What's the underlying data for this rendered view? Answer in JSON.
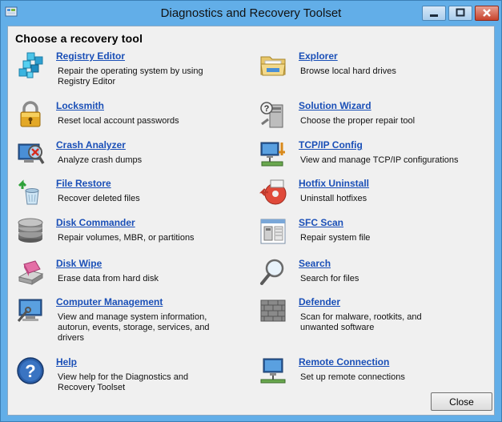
{
  "window": {
    "title": "Diagnostics and Recovery Toolset"
  },
  "heading": "Choose a recovery tool",
  "tools_left": [
    {
      "name": "Registry Editor",
      "desc": "Repair the operating system by using Registry Editor",
      "icon": "registry-icon"
    },
    {
      "name": "Locksmith",
      "desc": "Reset local account passwords",
      "icon": "padlock-icon"
    },
    {
      "name": "Crash Analyzer",
      "desc": "Analyze crash dumps",
      "icon": "crash-analyzer-icon"
    },
    {
      "name": "File Restore",
      "desc": "Recover deleted files",
      "icon": "recycle-bin-icon"
    },
    {
      "name": "Disk Commander",
      "desc": "Repair volumes, MBR, or partitions",
      "icon": "disk-stack-icon"
    },
    {
      "name": "Disk Wipe",
      "desc": "Erase data from hard disk",
      "icon": "eraser-icon"
    },
    {
      "name": "Computer Management",
      "desc": "View and manage system information, autorun, events, storage, services, and drivers",
      "icon": "computer-management-icon"
    },
    {
      "name": "Help",
      "desc": "View help for the Diagnostics and Recovery Toolset",
      "icon": "help-icon"
    }
  ],
  "tools_right": [
    {
      "name": "Explorer",
      "desc": "Browse local hard drives",
      "icon": "folder-icon"
    },
    {
      "name": "Solution Wizard",
      "desc": "Choose the proper repair tool",
      "icon": "wizard-icon"
    },
    {
      "name": "TCP/IP Config",
      "desc": "View and manage TCP/IP configurations",
      "icon": "network-config-icon"
    },
    {
      "name": "Hotfix Uninstall",
      "desc": "Uninstall hotfixes",
      "icon": "hotfix-uninstall-icon"
    },
    {
      "name": "SFC Scan",
      "desc": "Repair system file",
      "icon": "sfc-scan-icon"
    },
    {
      "name": "Search",
      "desc": "Search for files",
      "icon": "magnifier-icon"
    },
    {
      "name": "Defender",
      "desc": "Scan for malware, rootkits, and unwanted software",
      "icon": "brick-wall-icon"
    },
    {
      "name": "Remote Connection",
      "desc": "Set up remote connections",
      "icon": "remote-connection-icon"
    }
  ],
  "buttons": {
    "close": "Close"
  },
  "colors": {
    "link": "#1a4fb7",
    "frame": "#62aee8",
    "client_bg": "#f0f0f0"
  }
}
